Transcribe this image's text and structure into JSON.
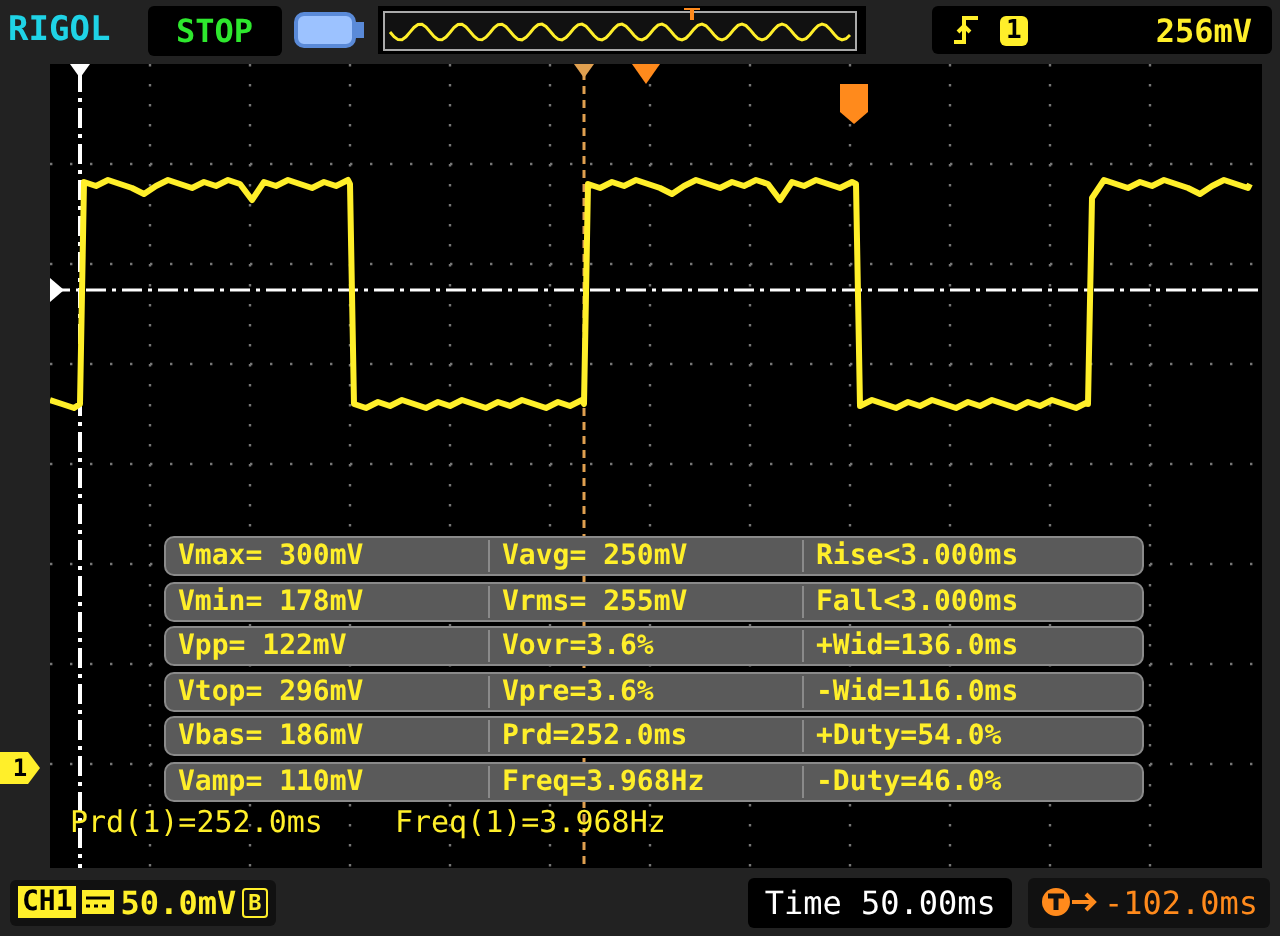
{
  "brand": "RIGOL",
  "run_state": "STOP",
  "trigger": {
    "channel": "1",
    "level": "256mV"
  },
  "channel_marker": "1",
  "measurements": [
    {
      "cells": [
        "Vmax= 300mV",
        "Vavg= 250mV",
        "Rise<3.000ms"
      ]
    },
    {
      "cells": [
        "Vmin= 178mV",
        "Vrms= 255mV",
        "Fall<3.000ms"
      ]
    },
    {
      "cells": [
        "Vpp= 122mV",
        "Vovr=3.6%",
        "+Wid=136.0ms"
      ]
    },
    {
      "cells": [
        "Vtop= 296mV",
        "Vpre=3.6%",
        "-Wid=116.0ms"
      ]
    },
    {
      "cells": [
        "Vbas= 186mV",
        "Prd=252.0ms",
        "+Duty=54.0%"
      ]
    },
    {
      "cells": [
        "Vamp= 110mV",
        "Freq=3.968Hz",
        "-Duty=46.0%"
      ]
    }
  ],
  "readouts": [
    "Prd(1)=252.0ms",
    "Freq(1)=3.968Hz"
  ],
  "channel": {
    "label": "CH1",
    "scale": "50.0mV",
    "bandwidth_limit": "B"
  },
  "timebase": "Time 50.00ms",
  "trigger_offset": "-102.0ms"
}
